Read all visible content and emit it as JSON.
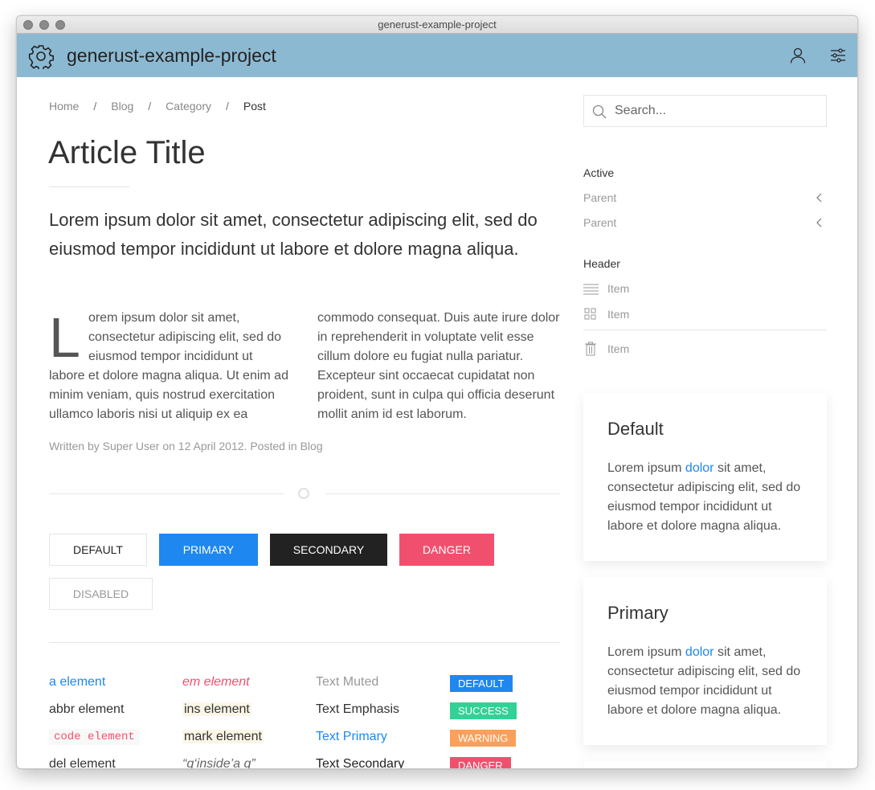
{
  "window": {
    "title": "generust-example-project"
  },
  "appbar": {
    "title": "generust-example-project"
  },
  "breadcrumb": {
    "items": [
      "Home",
      "Blog",
      "Category",
      "Post"
    ],
    "separator": "/"
  },
  "article": {
    "title": "Article Title",
    "lead": "Lorem ipsum dolor sit amet, consectetur adipiscing elit, sed do eiusmod tempor incididunt ut labore et dolore magna aliqua.",
    "dropcap": "L",
    "col1": "orem ipsum dolor sit amet, consectetur adipiscing elit, sed do eiusmod tempor incididunt ut labore et dolore magna aliqua. Ut enim ad minim veniam, quis nostrud exercitation ullamco laboris nisi ut aliquip ex ea",
    "col2": "commodo consequat. Duis aute irure dolor in reprehenderit in voluptate velit esse cillum dolore eu fugiat nulla pariatur. Excepteur sint occaecat cupidatat non proident, sunt in culpa qui officia deserunt mollit anim id est laborum.",
    "meta": "Written by Super User on 12 April 2012. Posted in Blog"
  },
  "buttons": {
    "default": "DEFAULT",
    "primary": "PRIMARY",
    "secondary": "SECONDARY",
    "danger": "DANGER",
    "disabled": "DISABLED"
  },
  "elements": {
    "col1": [
      "a element",
      "abbr element",
      "code element",
      "del element"
    ],
    "col2": [
      "em element",
      "ins element",
      "mark element",
      "“q‘inside’a q”"
    ],
    "col3": [
      "Text Muted",
      "Text Emphasis",
      "Text Primary",
      "Text Secondary"
    ],
    "badges": [
      {
        "label": "DEFAULT",
        "color": "#1e87f0"
      },
      {
        "label": "SUCCESS",
        "color": "#32d296"
      },
      {
        "label": "WARNING",
        "color": "#faa05a"
      },
      {
        "label": "DANGER",
        "color": "#f0506e"
      }
    ]
  },
  "search": {
    "placeholder": "Search..."
  },
  "nav": {
    "active": "Active",
    "parent1": "Parent",
    "parent2": "Parent",
    "header": "Header",
    "item1": "Item",
    "item2": "Item",
    "item3": "Item"
  },
  "cards": [
    {
      "title": "Default",
      "before": "Lorem ipsum ",
      "link": "dolor",
      "after": " sit amet, consectetur adipiscing elit, sed do eiusmod tempor incididunt ut labore et dolore magna aliqua."
    },
    {
      "title": "Primary",
      "before": "Lorem ipsum ",
      "link": "dolor",
      "after": " sit amet, consectetur adipiscing elit, sed do eiusmod tempor incididunt ut labore et dolore magna aliqua."
    }
  ],
  "colors": {
    "appbar": "#8cb9d2",
    "primary": "#1e87f0",
    "danger": "#f0506e",
    "secondary": "#222222"
  },
  "icons": [
    "gear-icon",
    "user-icon",
    "settings-sliders-icon",
    "search-icon",
    "chevron-left-icon",
    "list-icon",
    "grid-icon",
    "trash-icon"
  ]
}
